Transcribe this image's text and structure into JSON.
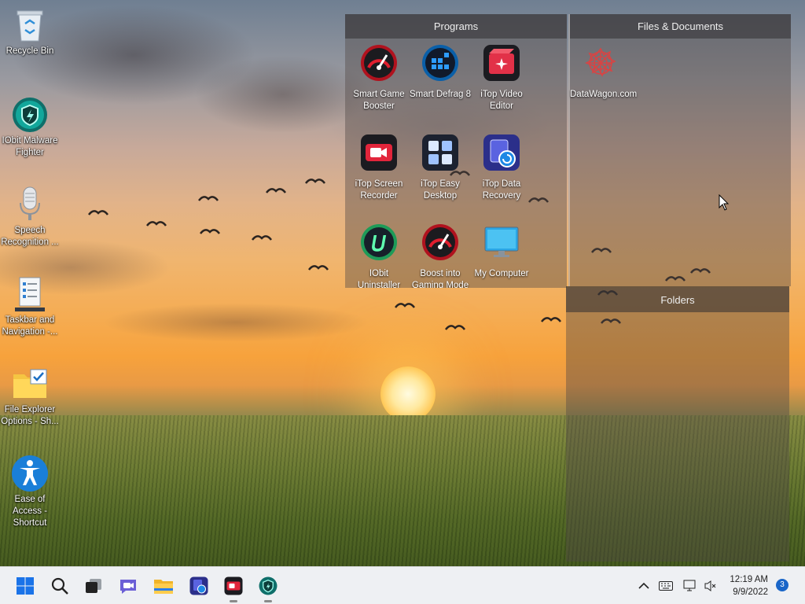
{
  "desktop_icons": [
    {
      "label": "Recycle Bin",
      "icon": "recycle-bin-icon"
    },
    {
      "label": "IObit Malware Fighter",
      "icon": "iobit-malware-fighter-icon"
    },
    {
      "label": "Speech Recognition ...",
      "icon": "microphone-icon"
    },
    {
      "label": "Taskbar and Navigation -...",
      "icon": "taskbar-settings-icon"
    },
    {
      "label": "File Explorer Options - Sh...",
      "icon": "folder-check-icon"
    },
    {
      "label": "Ease of Access - Shortcut",
      "icon": "accessibility-icon"
    }
  ],
  "fences": {
    "programs": {
      "title": "Programs",
      "items": [
        {
          "label": "Smart Game Booster",
          "icon": "speedometer-icon"
        },
        {
          "label": "Smart Defrag 8",
          "icon": "defrag-icon"
        },
        {
          "label": "iTop Video Editor",
          "icon": "video-editor-icon"
        },
        {
          "label": "iTop Screen Recorder",
          "icon": "screen-recorder-icon"
        },
        {
          "label": "iTop Easy Desktop",
          "icon": "easy-desktop-icon"
        },
        {
          "label": "iTop Data Recovery",
          "icon": "data-recovery-icon"
        },
        {
          "label": "IObit Uninstaller",
          "icon": "uninstaller-icon"
        },
        {
          "label": "Boost into Gaming Mode",
          "icon": "speedometer-icon"
        },
        {
          "label": "My Computer",
          "icon": "monitor-icon"
        }
      ]
    },
    "files": {
      "title": "Files & Documents",
      "items": [
        {
          "label": "DataWagon.com",
          "icon": "web-shortcut-icon"
        }
      ]
    },
    "folders": {
      "title": "Folders"
    }
  },
  "taskbar": {
    "apps": [
      "start-icon",
      "search-icon",
      "task-view-icon",
      "chat-icon",
      "file-explorer-icon",
      "itop-data-recovery-icon",
      "itop-screen-recorder-icon",
      "iobit-malware-fighter-icon"
    ],
    "time": "12:19 AM",
    "date": "9/9/2022",
    "notification_count": "3"
  }
}
